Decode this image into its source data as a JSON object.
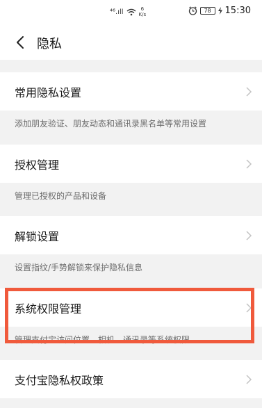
{
  "status_bar": {
    "signal": "⁴⁶.ıll",
    "net_speed_value": "6",
    "net_speed_unit": "K/s",
    "battery": "78",
    "time": "15:30"
  },
  "nav": {
    "title": "隐私"
  },
  "items": [
    {
      "label": "常用隐私设置",
      "description": "添加朋友验证、朋友动态和通讯录黑名单等常用设置"
    },
    {
      "label": "授权管理",
      "description": "管理已授权的产品和设备"
    },
    {
      "label": "解锁设置",
      "description": "设置指纹/手势解锁来保护隐私信息"
    },
    {
      "label": "系统权限管理",
      "description": "管理支付宝访问位置、相机、通讯录等系统权限"
    },
    {
      "label": "支付宝隐私权政策",
      "description": ""
    }
  ],
  "colors": {
    "highlight": "#f05a3c",
    "background": "#f2f2f2"
  }
}
